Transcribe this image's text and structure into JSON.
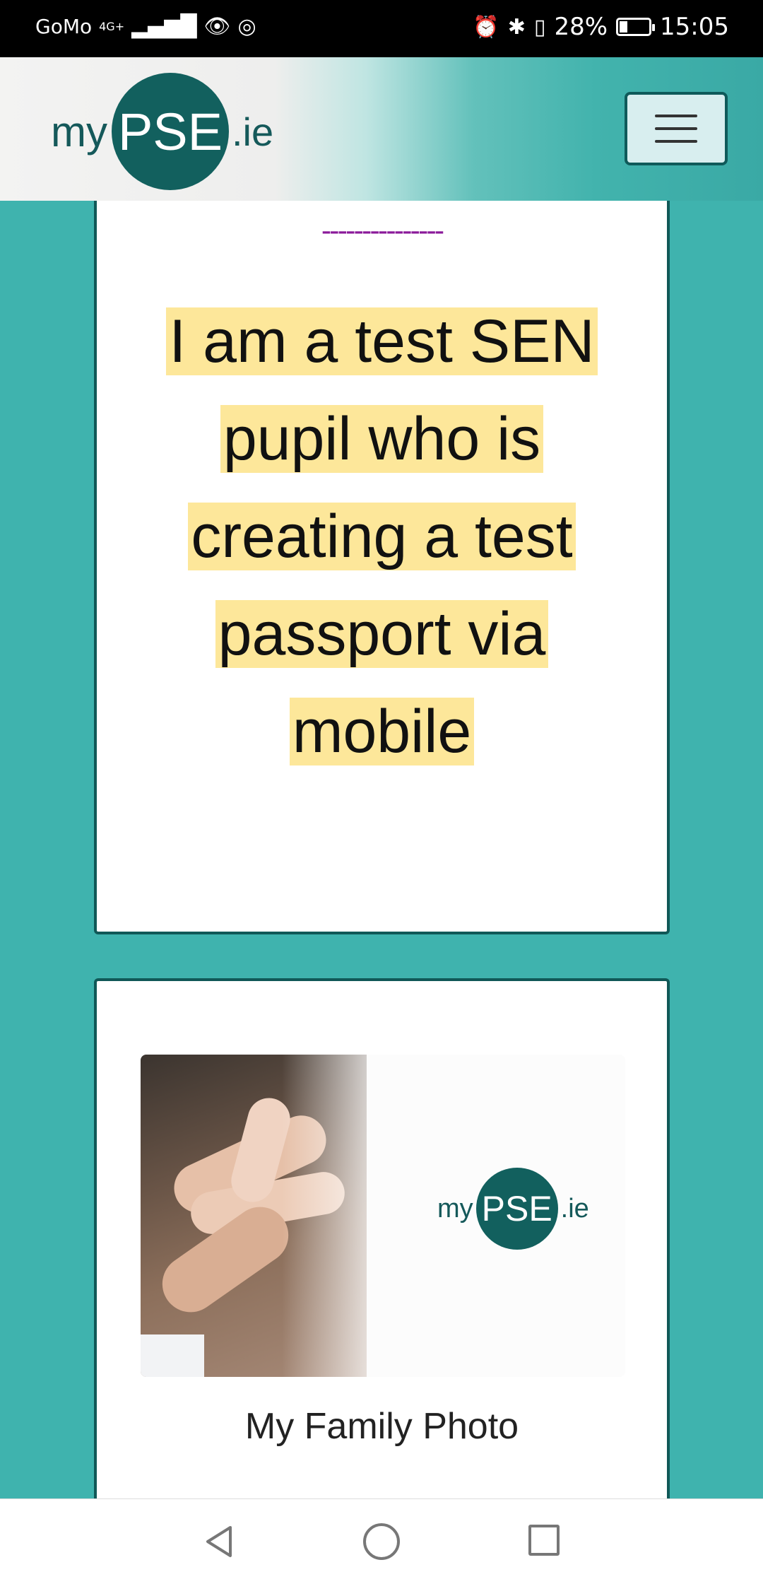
{
  "status_bar": {
    "carrier": "GoMo",
    "network": "4G+",
    "battery_percent": "28%",
    "battery_level": 0.28,
    "time": "15:05",
    "icons": [
      "signal-icon",
      "eye-icon",
      "hotspot-icon",
      "alarm-icon",
      "bluetooth-icon",
      "vibrate-icon",
      "battery-icon"
    ]
  },
  "header": {
    "logo": {
      "my": "my",
      "pse": "PSE",
      "ie": ".ie"
    },
    "menu_icon": "hamburger-menu-icon"
  },
  "bio_card": {
    "dashes": "---------------",
    "text": "I am a test SEN pupil who is creating a test passport via mobile"
  },
  "photo_card": {
    "logo": {
      "my": "my",
      "pse": "PSE",
      "ie": ".ie"
    },
    "caption": "My Family Photo"
  },
  "nav_bar": {
    "icons": [
      "back-icon",
      "home-icon",
      "recent-apps-icon"
    ]
  },
  "colors": {
    "teal_background": "#3fb3ae",
    "logo_dark_teal": "#12605e",
    "highlight_yellow": "#fde79a",
    "card_border": "#105857",
    "dash_purple": "#8a1a9a"
  }
}
